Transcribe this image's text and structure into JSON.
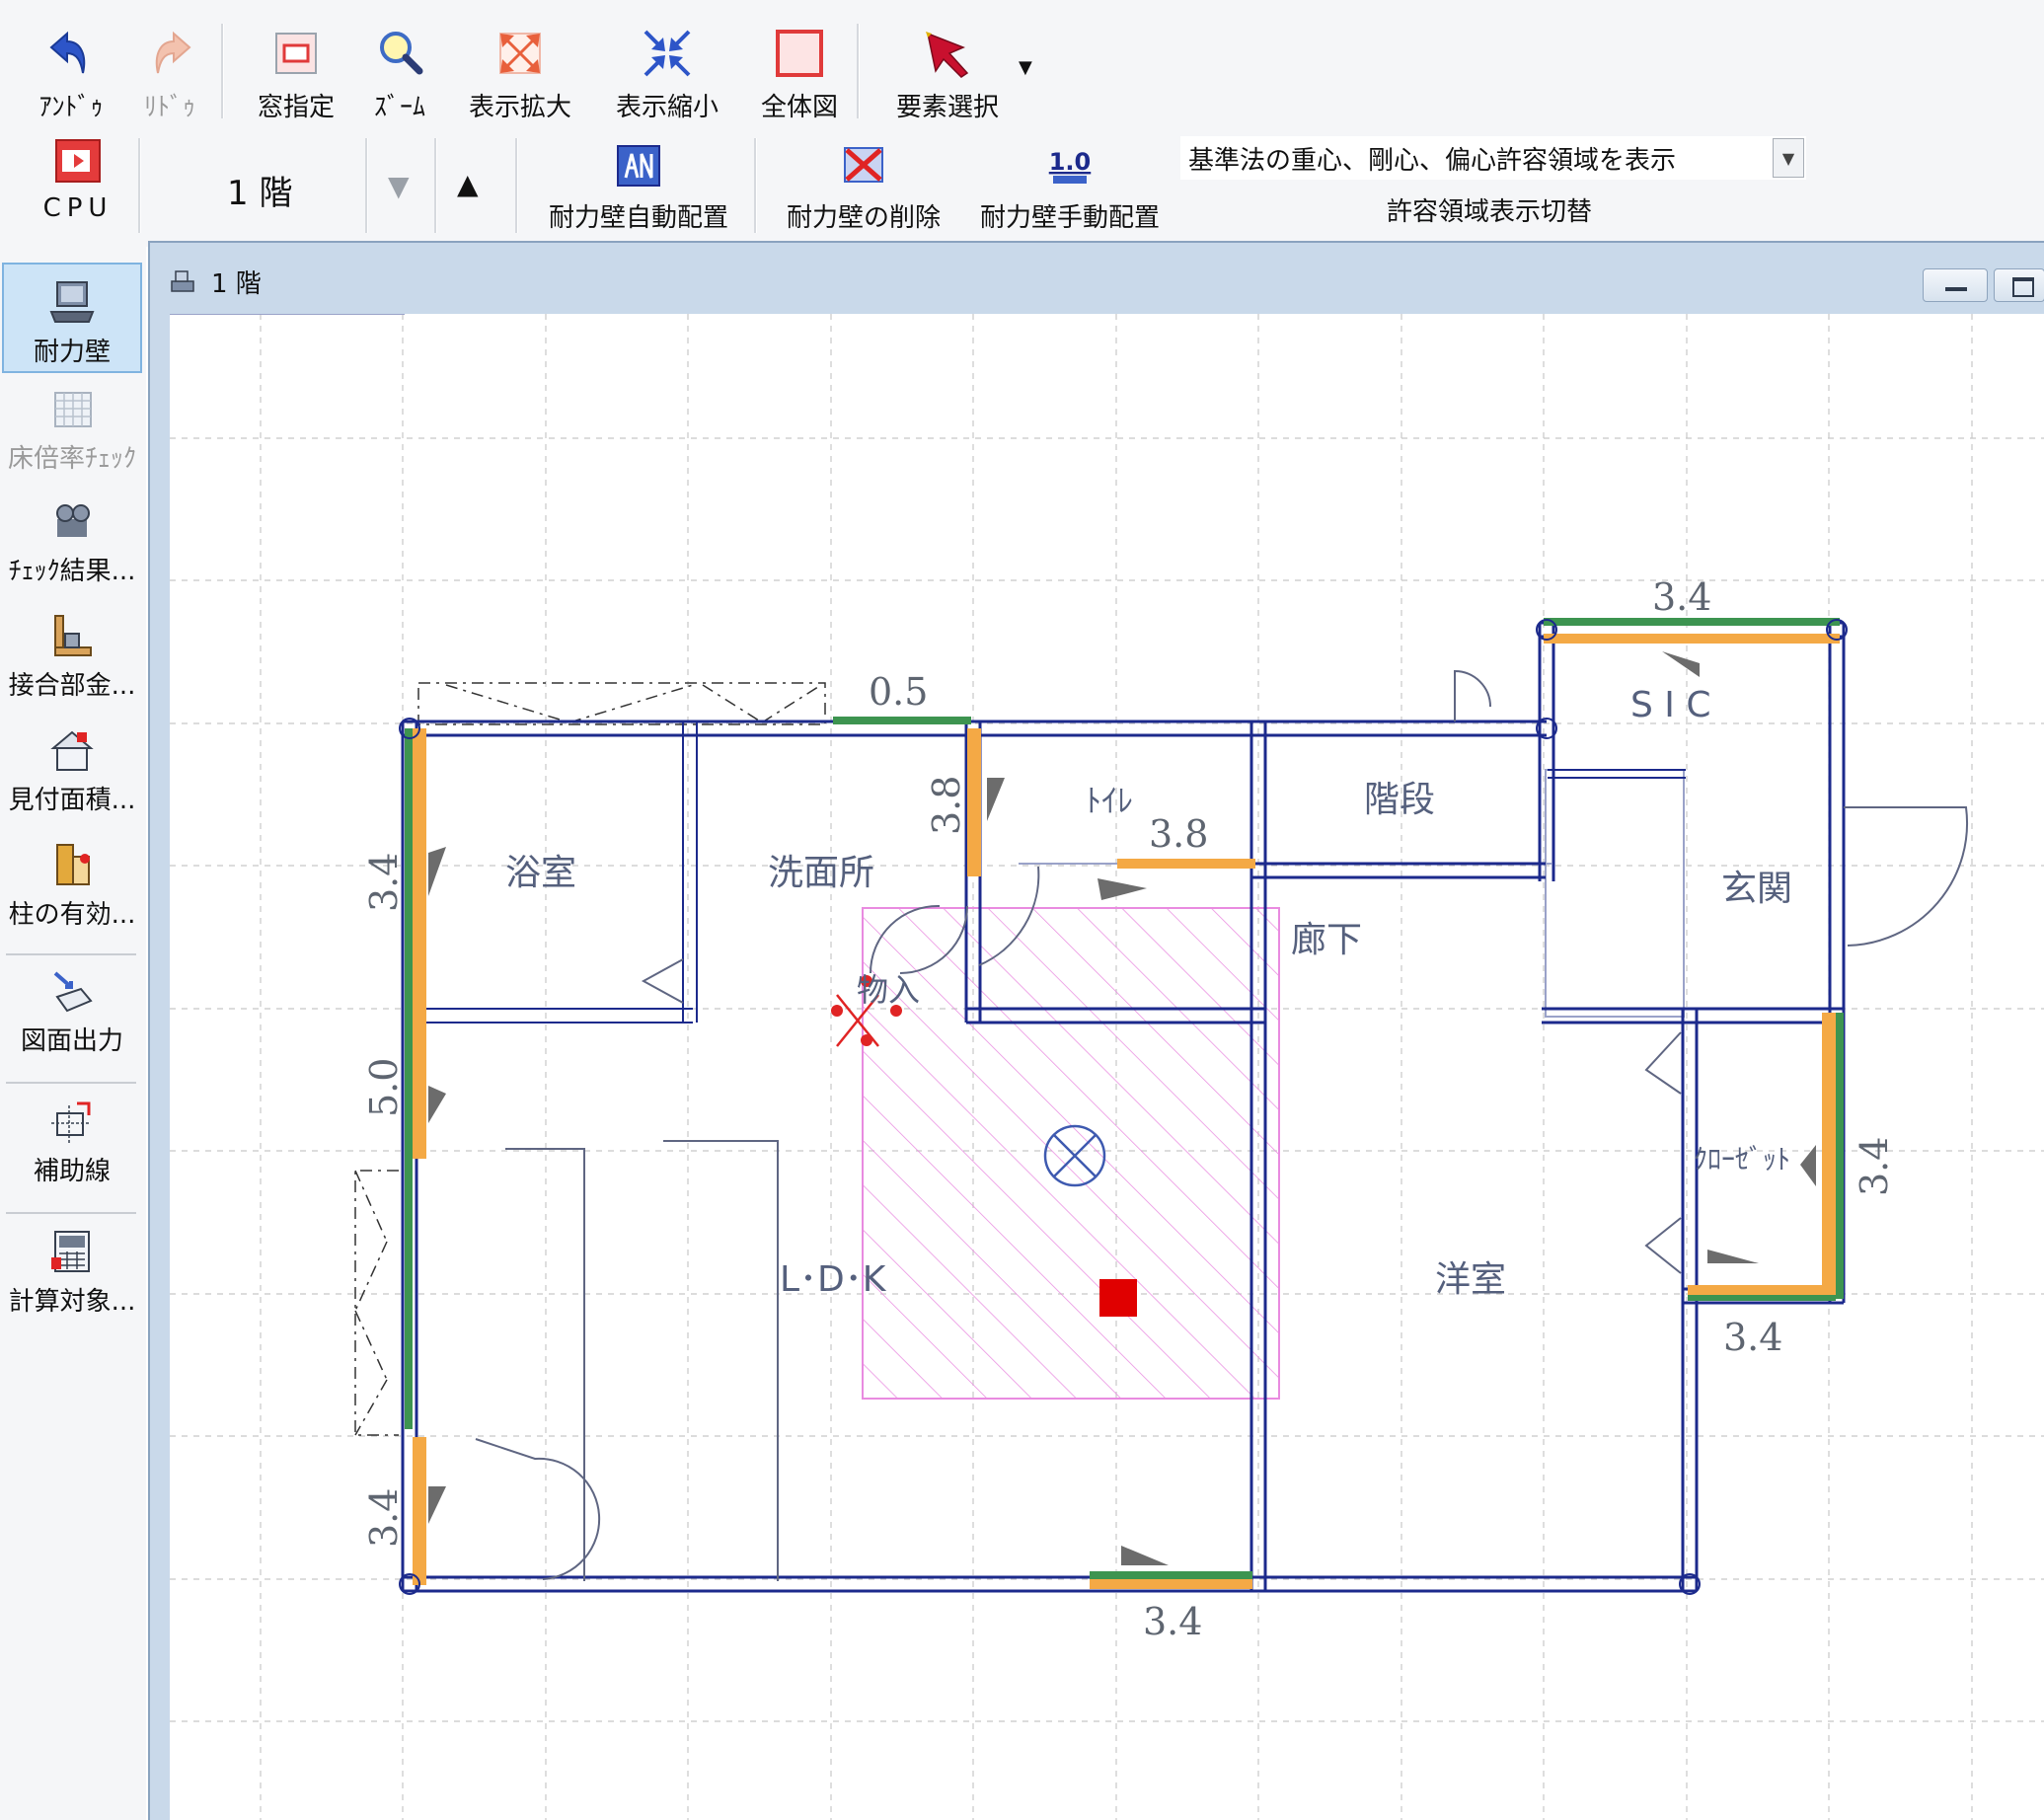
{
  "toolbar": {
    "undo": "ｱﾝﾄﾞｩ",
    "redo": "ﾘﾄﾞｩ",
    "window": "窓指定",
    "zoom": "ｽﾞｰﾑ",
    "zoom_in": "表示拡大",
    "zoom_out": "表示縮小",
    "full_view": "全体図",
    "select": "要素選択",
    "cpu": "CPU",
    "floor": "1 階",
    "auto_place": "耐力壁自動配置",
    "delete_wall": "耐力壁の削除",
    "manual_place": "耐力壁手動配置",
    "area_option": "基準法の重心、剛心、偏心許容領域を表示",
    "area_toggle": "許容領域表示切替"
  },
  "sidebar": {
    "items": [
      {
        "label": "耐力壁"
      },
      {
        "label": "床倍率ﾁｪｯｸ"
      },
      {
        "label": "ﾁｪｯｸ結果..."
      },
      {
        "label": "接合部金..."
      },
      {
        "label": "見付面積..."
      },
      {
        "label": "柱の有効..."
      },
      {
        "label": "図面出力"
      },
      {
        "label": "補助線"
      },
      {
        "label": "計算対象..."
      }
    ]
  },
  "document": {
    "title": "1 階"
  },
  "plan": {
    "rooms": {
      "bath": "浴室",
      "washroom": "洗面所",
      "toilet": "ﾄｲﾚ",
      "stairs": "階段",
      "sic": "S I C",
      "entrance": "玄関",
      "hallway": "廊下",
      "storage": "物入",
      "ldk": "L･D･K",
      "western_room": "洋室",
      "closet": "ｸﾛｰｾﾞｯﾄ"
    },
    "dims": {
      "left_top": "3.4",
      "left_mid": "5.0",
      "left_bottom": "3.4",
      "top_mid": "0.5",
      "toilet_vert": "3.8",
      "toilet_horiz": "3.8",
      "sic_top": "3.4",
      "closet_right": "3.4",
      "closet_bottom": "3.4",
      "bottom_mid": "3.4"
    }
  },
  "colors": {
    "wall": "#1c2a8c",
    "bearing_wall": "#f4a945",
    "bearing_edge": "#3d9450",
    "eccentricity_zone": "#e98be0",
    "centroid": "#e00000"
  }
}
